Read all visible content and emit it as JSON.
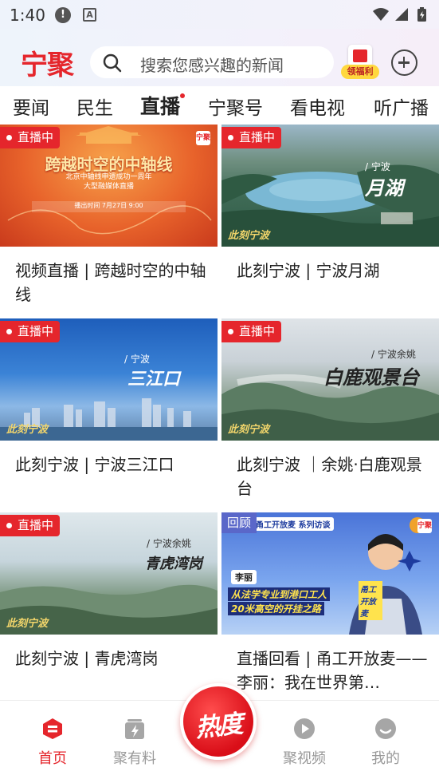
{
  "status_bar": {
    "time": "1:40",
    "alert_glyph": "!",
    "app_glyph": "A"
  },
  "header": {
    "logo": "宁聚",
    "search_placeholder": "搜索您感兴趣的新闻",
    "gift_label": "领福利"
  },
  "tabs": [
    {
      "label": "要闻"
    },
    {
      "label": "民生"
    },
    {
      "label": "直播",
      "active": true
    },
    {
      "label": "宁聚号"
    },
    {
      "label": "看电视"
    },
    {
      "label": "听广播"
    }
  ],
  "cards": [
    {
      "badge": "直播中",
      "title": "视频直播 | 跨越时空的中轴线",
      "image_text": {
        "headline": "跨越时空的中轴线",
        "sub1": "北京中轴线申遗成功一周年",
        "sub2": "大型融媒体直播",
        "sub3": "播出时间  7月27日 9:00",
        "corner": "宁聚"
      }
    },
    {
      "badge": "直播中",
      "title": "此刻宁波 | 宁波月湖",
      "image_text": {
        "place": "/ 宁波",
        "headline": "月湖",
        "brand": "此刻宁波"
      }
    },
    {
      "badge": "直播中",
      "title": "此刻宁波 | 宁波三江口",
      "image_text": {
        "place": "/ 宁波",
        "headline": "三江口",
        "brand": "此刻宁波"
      }
    },
    {
      "badge": "直播中",
      "title": "此刻宁波 ｜余姚·白鹿观景台",
      "image_text": {
        "place": "/ 宁波余姚",
        "headline": "白鹿观景台",
        "brand": "此刻宁波"
      }
    },
    {
      "badge": "直播中",
      "title": "此刻宁波 | 青虎湾岗",
      "image_text": {
        "place": "/ 宁波余姚",
        "headline": "青虎湾岗",
        "brand": "此刻宁波"
      }
    },
    {
      "badge": "回顾",
      "title": "直播回看 | 甬工开放麦——李丽：我在世界第…",
      "image_text": {
        "top": "甬工开放麦 系列访谈",
        "name": "李丽",
        "line1": "从法学专业到港口工人",
        "line2": "20米高空的开挂之路",
        "corner": "宁聚",
        "side": "甬工开放麦"
      }
    }
  ],
  "bottom_nav": {
    "items": [
      {
        "label": "首页",
        "active": true
      },
      {
        "label": "聚有料"
      },
      {
        "label": "聚视频"
      },
      {
        "label": "我的"
      }
    ],
    "center_label": "热度"
  },
  "colors": {
    "accent": "#e5262c",
    "inactive": "#999999",
    "replay": "#5a67c9"
  }
}
